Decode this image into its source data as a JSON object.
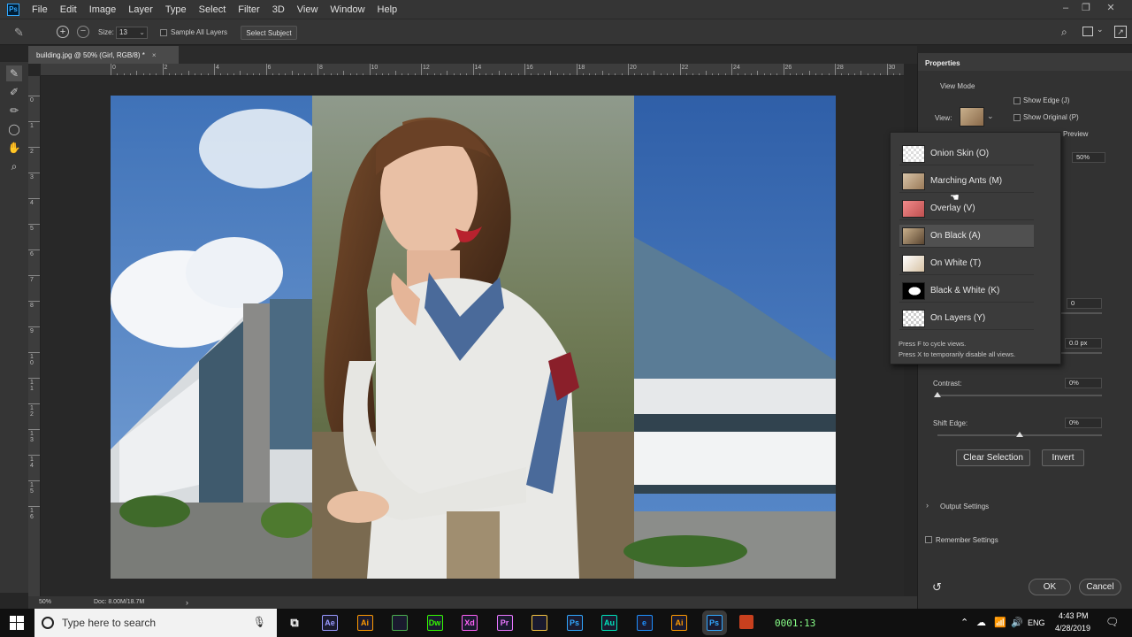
{
  "app": {
    "logo": "Ps",
    "menu": [
      "File",
      "Edit",
      "Image",
      "Layer",
      "Type",
      "Select",
      "Filter",
      "3D",
      "View",
      "Window",
      "Help"
    ],
    "window_controls": [
      "–",
      "❐",
      "✕"
    ]
  },
  "options": {
    "size_label": "Size:",
    "size_value": "13",
    "sample_all_layers": "Sample All Layers",
    "select_subject": "Select Subject"
  },
  "document": {
    "tab_title": "building.jpg @ 50% (Girl, RGB/8) *",
    "tab_close": "×",
    "ruler_top_labels": [
      "0",
      "2",
      "4",
      "6",
      "8",
      "10",
      "12",
      "14",
      "16",
      "18",
      "20",
      "22",
      "24",
      "26",
      "28",
      "30"
    ],
    "ruler_left_labels": [
      "0",
      "1",
      "2",
      "3",
      "4",
      "5",
      "6",
      "7",
      "8",
      "9",
      "1 0",
      "1 1",
      "1 2",
      "1 3",
      "1 4",
      "1 5",
      "1 6"
    ],
    "zoom": "50%",
    "doc_info": "Doc: 8.00M/18.7M",
    "status_arrow": "›"
  },
  "properties": {
    "title": "Properties",
    "view_mode_label": "View Mode",
    "view_label": "View:",
    "show_edge": "Show Edge (J)",
    "show_original": "Show Original (P)",
    "preview": "Preview",
    "opacity_value": "50%",
    "radius_value": "0",
    "feather_value": "0.0 px",
    "contrast_label": "Contrast:",
    "contrast_value": "0%",
    "shift_edge_label": "Shift Edge:",
    "shift_edge_value": "0%",
    "clear_selection": "Clear Selection",
    "invert": "Invert",
    "output_settings": "Output Settings",
    "remember_settings": "Remember Settings",
    "ok": "OK",
    "cancel": "Cancel"
  },
  "view_menu": {
    "items": [
      {
        "label": "Onion Skin (O)",
        "icon": "onion-skin-thumb"
      },
      {
        "label": "Marching Ants (M)",
        "icon": "marching-ants-thumb"
      },
      {
        "label": "Overlay (V)",
        "icon": "overlay-thumb"
      },
      {
        "label": "On Black (A)",
        "icon": "on-black-thumb",
        "selected": true
      },
      {
        "label": "On White (T)",
        "icon": "on-white-thumb"
      },
      {
        "label": "Black & White (K)",
        "icon": "black-white-thumb"
      },
      {
        "label": "On Layers (Y)",
        "icon": "on-layers-thumb"
      }
    ],
    "hint1": "Press F to cycle views.",
    "hint2": "Press X to temporarily disable all views."
  },
  "taskbar": {
    "search_placeholder": "Type here to search",
    "apps": [
      "Ae",
      "Ai",
      "",
      "Dw",
      "Xd",
      "Pr",
      "",
      "Ps",
      "Au",
      "e",
      "Ai",
      "Ps"
    ],
    "app_colors": [
      "#9999ff",
      "#ff9a00",
      "#4caf50",
      "#35fa00",
      "#ff61f6",
      "#ea77ff",
      "#f5c542",
      "#31a8ff",
      "#00e4bb",
      "#1e90ff",
      "#ff9a00",
      "#31a8ff"
    ],
    "counter": "0001:13",
    "lang": "ENG",
    "time": "4:43 PM",
    "date": "4/28/2019"
  }
}
